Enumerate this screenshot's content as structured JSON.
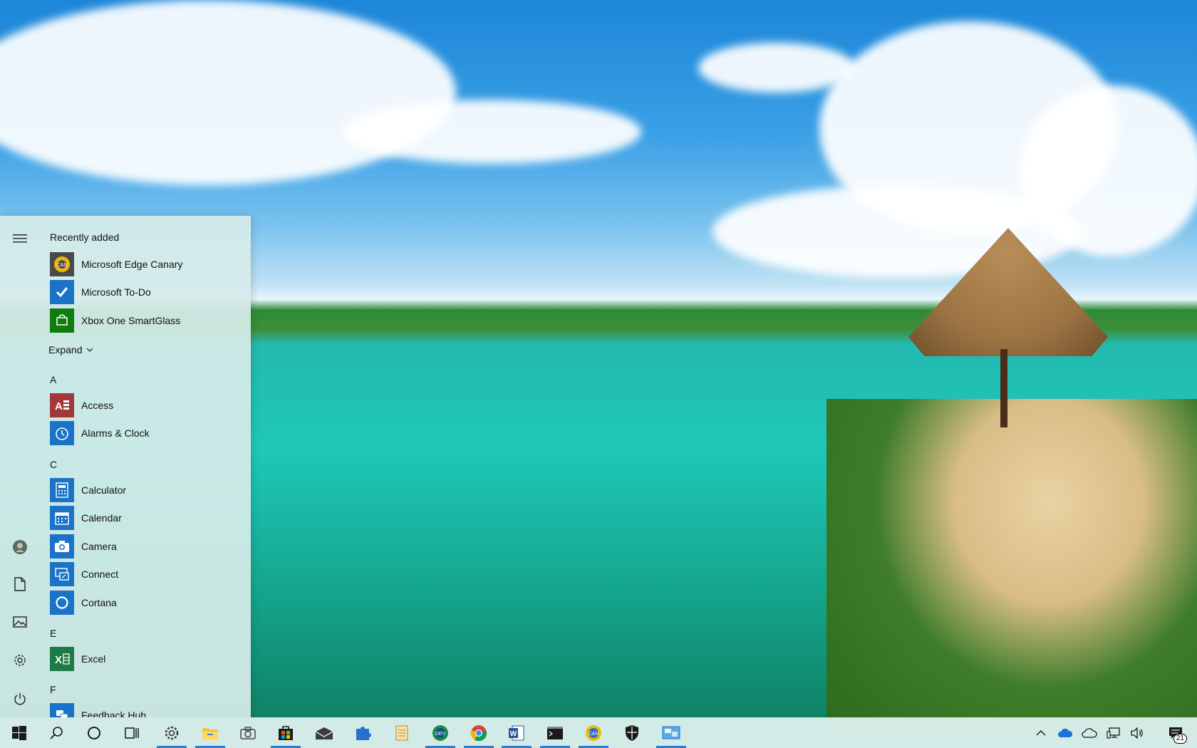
{
  "start_menu": {
    "recently_added_title": "Recently added",
    "recent": [
      {
        "label": "Microsoft Edge Canary",
        "icon": "edge-canary-icon"
      },
      {
        "label": "Microsoft To-Do",
        "icon": "todo-icon"
      },
      {
        "label": "Xbox One SmartGlass",
        "icon": "xbox-smartglass-icon"
      }
    ],
    "expand_label": "Expand",
    "groups": [
      {
        "letter": "A",
        "apps": [
          {
            "label": "Access",
            "icon": "access-icon"
          },
          {
            "label": "Alarms & Clock",
            "icon": "alarm-clock-icon"
          }
        ]
      },
      {
        "letter": "C",
        "apps": [
          {
            "label": "Calculator",
            "icon": "calculator-icon"
          },
          {
            "label": "Calendar",
            "icon": "calendar-icon"
          },
          {
            "label": "Camera",
            "icon": "camera-icon"
          },
          {
            "label": "Connect",
            "icon": "connect-icon"
          },
          {
            "label": "Cortana",
            "icon": "cortana-icon"
          }
        ]
      },
      {
        "letter": "E",
        "apps": [
          {
            "label": "Excel",
            "icon": "excel-icon"
          }
        ]
      },
      {
        "letter": "F",
        "apps": [
          {
            "label": "Feedback Hub",
            "icon": "feedback-hub-icon"
          }
        ]
      }
    ]
  },
  "colors": {
    "accent": "#2b7bd0",
    "tile_blue": "#1a73c7",
    "excel_green": "#1d7a45",
    "access_red": "#a4373a",
    "xbox_green": "#107c10"
  },
  "taskbar": {
    "notification_count": "21"
  }
}
